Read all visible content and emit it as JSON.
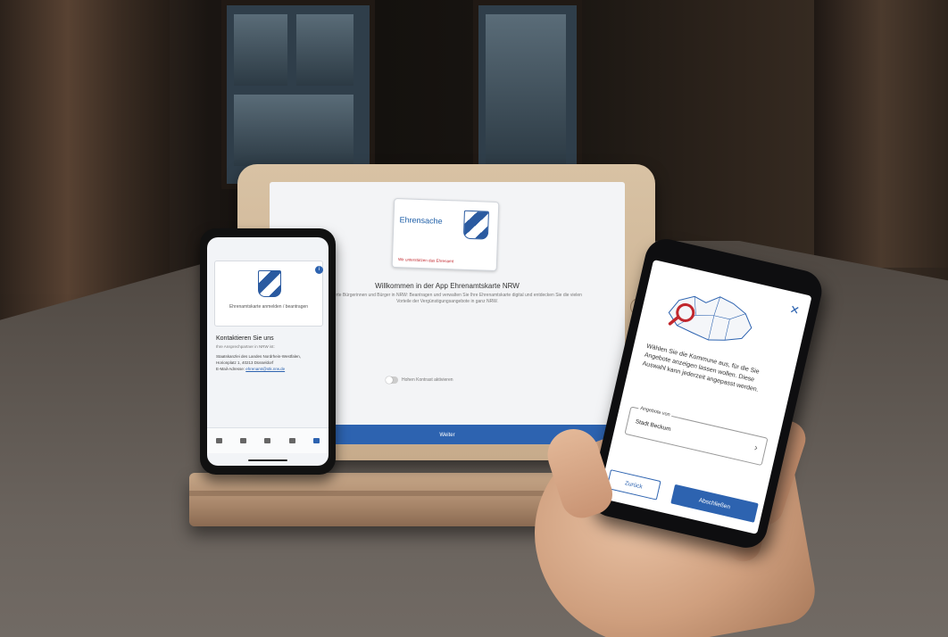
{
  "tablet": {
    "brand": "Ehrensache",
    "tagline": "Wir unterstützen das Ehrenamt",
    "title": "Willkommen in der App Ehrenamtskarte NRW",
    "description": "Für engagierte Bürgerinnen und Bürger in NRW: Beantragen und verwalten Sie Ihre Ehrenamtskarte digital und entdecken Sie die vielen Vorteile der Vergünstigungsangebote in ganz NRW.",
    "toggle_label": "Hohen Kontrast aktivieren",
    "continue_label": "Weiter"
  },
  "phone_left": {
    "card_label": "Ehrenamtskarte anmelden / beantragen",
    "heading": "Kontaktieren Sie uns",
    "subheading": "Ihre Ansprechpartner in NRW ist:",
    "address": "Staatskanzlei des Landes Nordrhein-Westfalen, Horionplatz 1, 40213 Düsseldorf",
    "email_prefix": "E-Mail-Adresse:",
    "email": "ehrenamt@stk.nrw.de"
  },
  "phone_right": {
    "close_icon": "close-icon",
    "instruction": "Wählen Sie die Kommune aus, für die Sie Angebote anzeigen lassen wollen. Diese Auswahl kann jederzeit angepasst werden.",
    "field_label": "Angebote von",
    "field_value": "Stadt Beckum",
    "back_label": "Zurück",
    "finish_label": "Abschließen"
  },
  "colors": {
    "accent": "#2d63b0",
    "marker": "#c1272d"
  }
}
